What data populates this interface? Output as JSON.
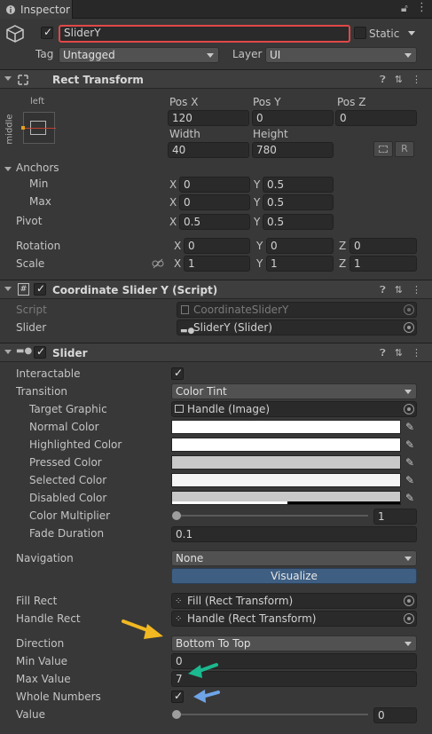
{
  "tab": {
    "title": "Inspector"
  },
  "object": {
    "name": "SliderY",
    "static_label": "Static",
    "tag_label": "Tag",
    "tag_value": "Untagged",
    "layer_label": "Layer",
    "layer_value": "UI"
  },
  "rect_transform": {
    "title": "Rect Transform",
    "anchor_h": "left",
    "anchor_v": "middle",
    "posx_label": "Pos X",
    "posy_label": "Pos Y",
    "posz_label": "Pos Z",
    "posx": "120",
    "posy": "0",
    "posz": "0",
    "width_label": "Width",
    "height_label": "Height",
    "width": "40",
    "height": "780",
    "r_btn": "R",
    "anchors_label": "Anchors",
    "min_label": "Min",
    "max_label": "Max",
    "x": "X",
    "y": "Y",
    "z": "Z",
    "min_x": "0",
    "min_y": "0.5",
    "max_x": "0",
    "max_y": "0.5",
    "pivot_label": "Pivot",
    "pivot_x": "0.5",
    "pivot_y": "0.5",
    "rotation_label": "Rotation",
    "rot_x": "0",
    "rot_y": "0",
    "rot_z": "0",
    "scale_label": "Scale",
    "scale_x": "1",
    "scale_y": "1",
    "scale_z": "1"
  },
  "script_comp": {
    "title": "Coordinate Slider Y (Script)",
    "script_label": "Script",
    "script_value": "CoordinateSliderY",
    "slider_label": "Slider",
    "slider_value": "SliderY (Slider)"
  },
  "slider": {
    "title": "Slider",
    "interactable_label": "Interactable",
    "transition_label": "Transition",
    "transition_value": "Color Tint",
    "target_graphic_label": "Target Graphic",
    "target_graphic_value": "Handle (Image)",
    "normal_color_label": "Normal Color",
    "highlighted_color_label": "Highlighted Color",
    "pressed_color_label": "Pressed Color",
    "selected_color_label": "Selected Color",
    "disabled_color_label": "Disabled Color",
    "color_multiplier_label": "Color Multiplier",
    "color_multiplier_value": "1",
    "fade_duration_label": "Fade Duration",
    "fade_duration_value": "0.1",
    "navigation_label": "Navigation",
    "navigation_value": "None",
    "visualize_label": "Visualize",
    "fill_rect_label": "Fill Rect",
    "fill_rect_value": "Fill (Rect Transform)",
    "handle_rect_label": "Handle Rect",
    "handle_rect_value": "Handle (Rect Transform)",
    "direction_label": "Direction",
    "direction_value": "Bottom To Top",
    "min_value_label": "Min Value",
    "min_value": "0",
    "max_value_label": "Max Value",
    "max_value": "7",
    "whole_numbers_label": "Whole Numbers",
    "value_label": "Value",
    "value": "0"
  },
  "colors": {
    "highlight_box": "#e04848",
    "arrow_yellow": "#f2b821",
    "arrow_teal": "#1bb98f",
    "arrow_blue": "#6fa4e8",
    "visualize_bg": "#3f5f82"
  }
}
